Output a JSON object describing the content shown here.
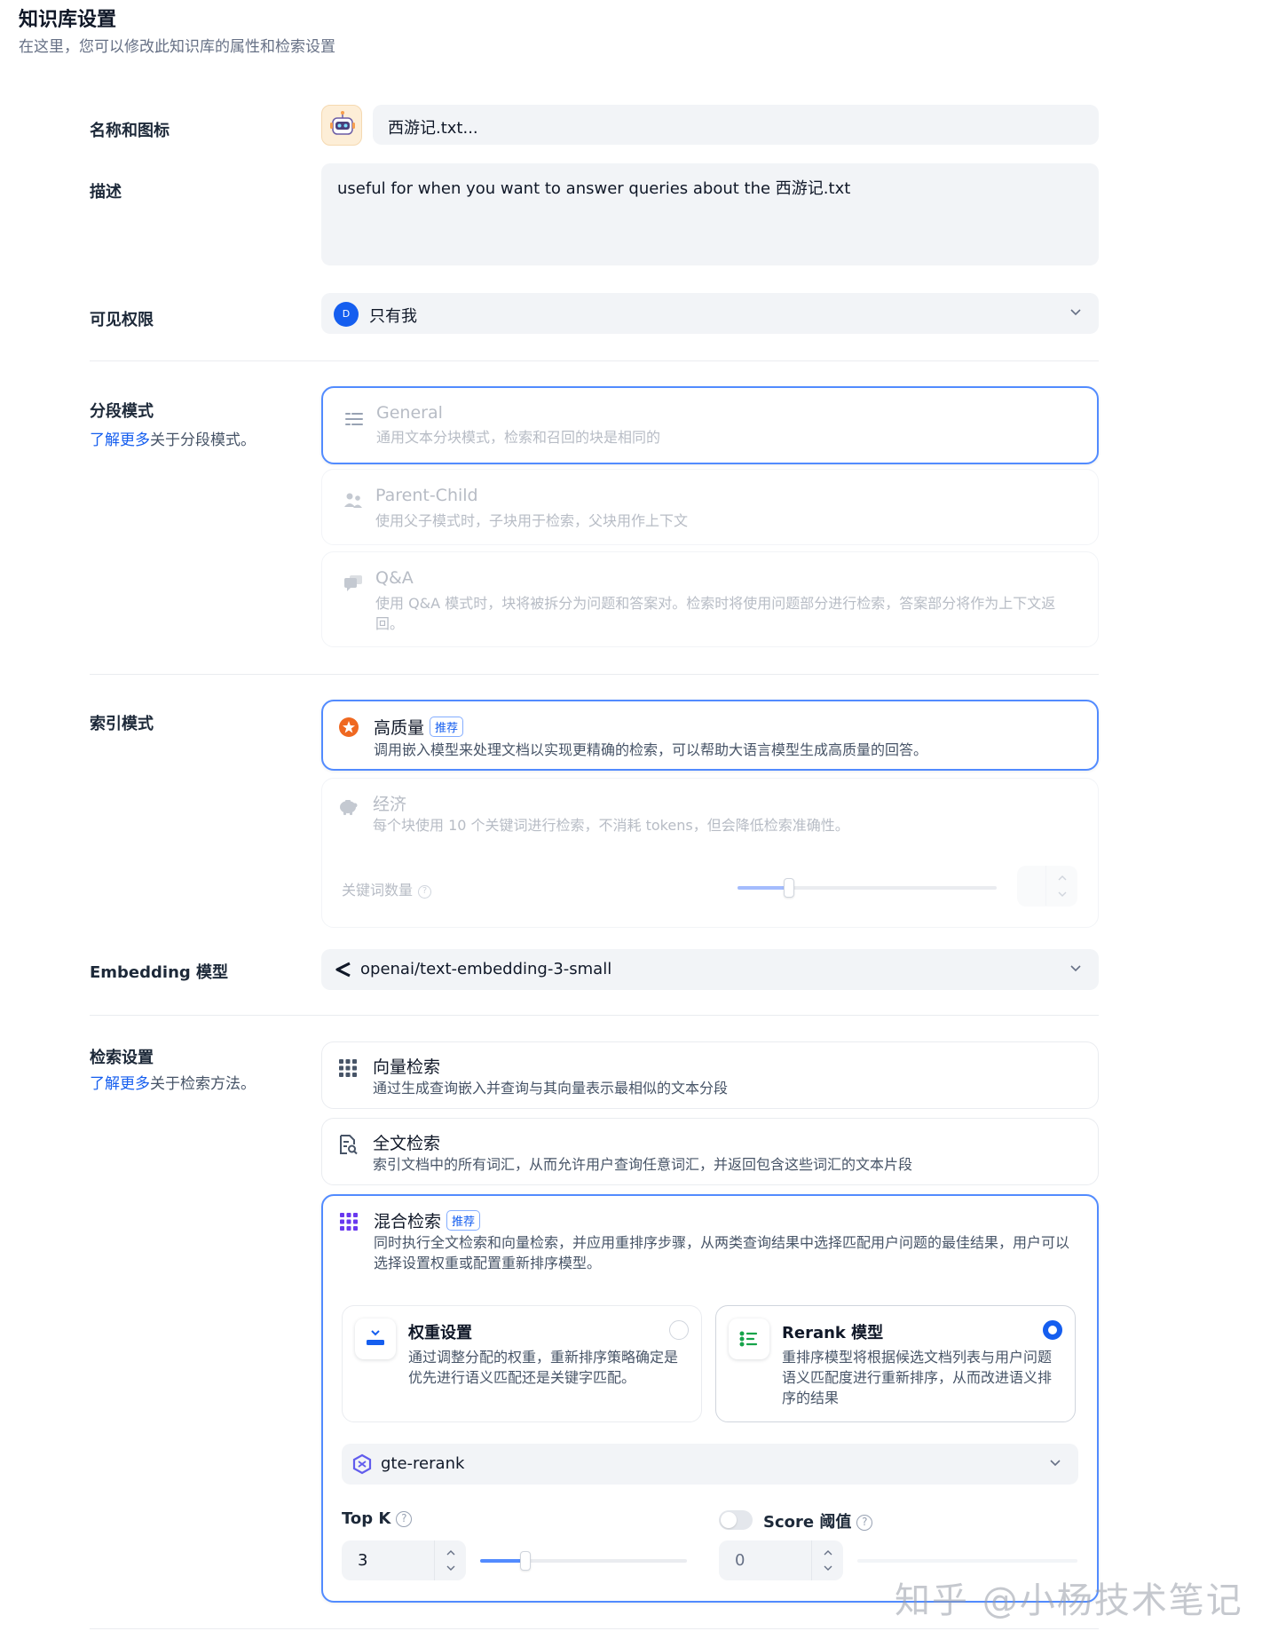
{
  "header": {
    "title": "知识库设置",
    "subtitle": "在这里，您可以修改此知识库的属性和检索设置"
  },
  "name_section": {
    "label": "名称和图标",
    "value": "西游记.txt..."
  },
  "description_section": {
    "label": "描述",
    "value": "useful for when you want to answer queries about the 西游记.txt"
  },
  "permission_section": {
    "label": "可见权限",
    "avatar_initial": "D",
    "value": "只有我"
  },
  "chunk_section": {
    "label": "分段模式",
    "learn_more": "了解更多",
    "learn_more_suffix": "关于分段模式。",
    "options": [
      {
        "title": "General",
        "desc": "通用文本分块模式，检索和召回的块是相同的",
        "selected": true
      },
      {
        "title": "Parent-Child",
        "desc": "使用父子模式时，子块用于检索，父块用作上下文",
        "selected": false
      },
      {
        "title": "Q&A",
        "desc": "使用 Q&A 模式时，块将被拆分为问题和答案对。检索时将使用问题部分进行检索，答案部分将作为上下文返回。",
        "selected": false
      }
    ]
  },
  "index_section": {
    "label": "索引模式",
    "options": [
      {
        "title": "高质量",
        "badge": "推荐",
        "desc": "调用嵌入模型来处理文档以实现更精确的检索，可以帮助大语言模型生成高质量的回答。",
        "selected": true
      },
      {
        "title": "经济",
        "desc": "每个块使用 10 个关键词进行检索，不消耗 tokens，但会降低检索准确性。",
        "selected": false
      }
    ],
    "keyword_label": "关键词数量",
    "keyword_slider": 0.2
  },
  "embedding_section": {
    "label": "Embedding 模型",
    "value": "openai/text-embedding-3-small"
  },
  "retrieval_section": {
    "label": "检索设置",
    "learn_more": "了解更多",
    "learn_more_suffix": "关于检索方法。",
    "options": [
      {
        "title": "向量检索",
        "desc": "通过生成查询嵌入并查询与其向量表示最相似的文本分段"
      },
      {
        "title": "全文检索",
        "desc": "索引文档中的所有词汇，从而允许用户查询任意词汇，并返回包含这些词汇的文本片段"
      },
      {
        "title": "混合检索",
        "badge": "推荐",
        "desc": "同时执行全文检索和向量检索，并应用重排序步骤，从两类查询结果中选择匹配用户问题的最佳结果，用户可以选择设置权重或配置重新排序模型。"
      }
    ],
    "weight": {
      "title": "权重设置",
      "desc": "通过调整分配的权重，重新排序策略确定是优先进行语义匹配还是关键字匹配。",
      "selected": false
    },
    "rerank": {
      "title": "Rerank 模型",
      "desc": "重排序模型将根据候选文档列表与用户问题语义匹配度进行重新排序，从而改进语义排序的结果",
      "selected": true
    },
    "rerank_model": "gte-rerank",
    "top_k_label": "Top K",
    "top_k_value": "3",
    "top_k_slider": 0.22,
    "score_label": "Score 阈值",
    "score_value": "0",
    "score_enabled": false
  },
  "watermark": "知乎 @小杨技术笔记",
  "colors": {
    "accent": "#155eef",
    "selected_border": "#528bff",
    "field_bg": "#f2f4f7"
  }
}
